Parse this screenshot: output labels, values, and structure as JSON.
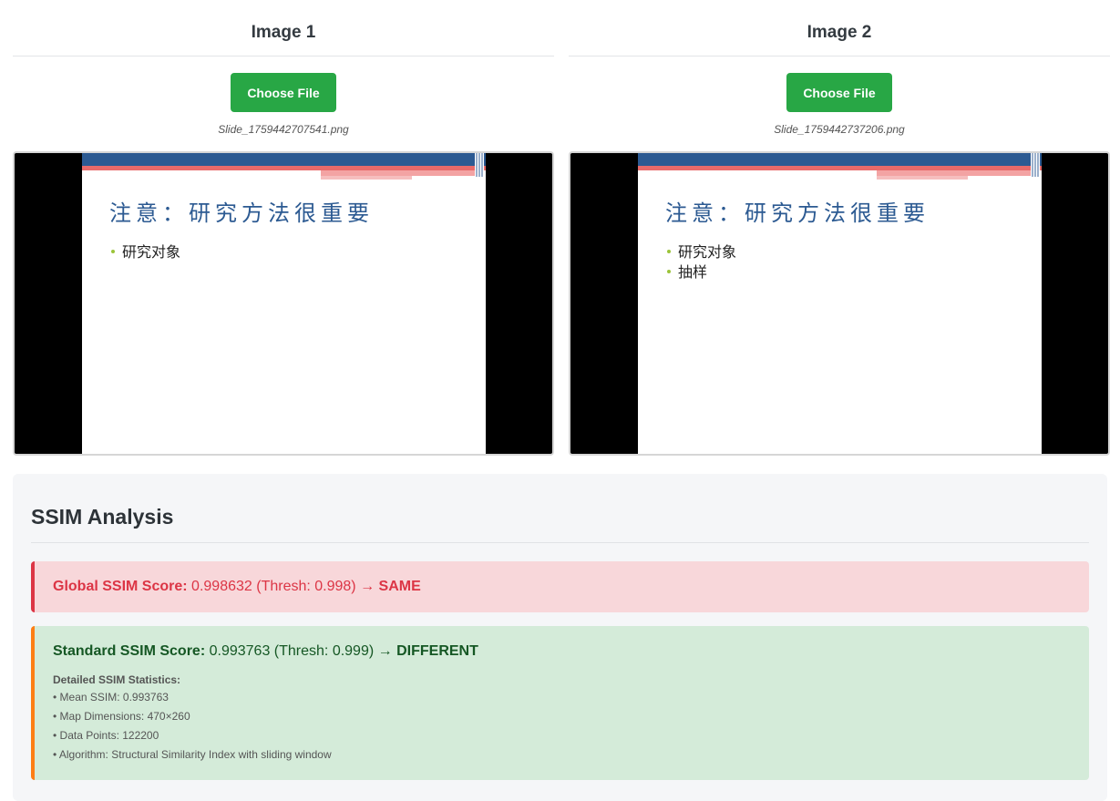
{
  "panels": [
    {
      "title": "Image 1",
      "button_label": "Choose File",
      "file_name": "Slide_1759442707541.png",
      "slide": {
        "title": "注意：研究方法很重要",
        "bullets": [
          "研究对象"
        ]
      }
    },
    {
      "title": "Image 2",
      "button_label": "Choose File",
      "file_name": "Slide_1759442737206.png",
      "slide": {
        "title": "注意：研究方法很重要",
        "bullets": [
          "研究对象",
          "抽样"
        ]
      }
    }
  ],
  "analysis": {
    "title": "SSIM Analysis",
    "global": {
      "label": "Global SSIM Score:",
      "value": "0.998632",
      "thresh": "(Thresh: 0.998)",
      "arrow": "→",
      "verdict": "SAME"
    },
    "standard": {
      "label": "Standard SSIM Score:",
      "value": "0.993763",
      "thresh": "(Thresh: 0.999)",
      "arrow": "→",
      "verdict": "DIFFERENT",
      "stats_heading": "Detailed SSIM Statistics:",
      "stats": [
        "• Mean SSIM: 0.993763",
        "• Map Dimensions: 470×260",
        "• Data Points: 122200",
        "• Algorithm: Structural Similarity Index with sliding window"
      ]
    }
  },
  "colors": {
    "button": "#28a745",
    "global_bg": "#f8d7da",
    "global_accent": "#dc3545",
    "standard_bg": "#d4ebd9",
    "standard_accent": "#fd7e14",
    "slide_blue": "#2c5a92",
    "bullet_green": "#9cc43a"
  }
}
